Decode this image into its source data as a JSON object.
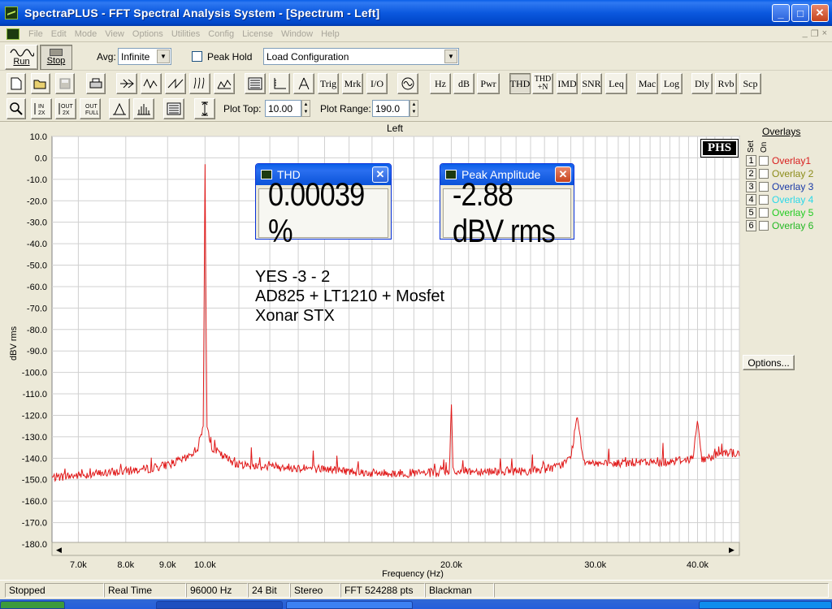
{
  "window": {
    "title": "SpectraPLUS - FFT Spectral Analysis System - [Spectrum - Left]",
    "minimize": "_",
    "maximize": "□",
    "close": "✕"
  },
  "menu": [
    "File",
    "Edit",
    "Mode",
    "View",
    "Options",
    "Utilities",
    "Config",
    "License",
    "Window",
    "Help"
  ],
  "mdi": {
    "minimize": "_",
    "restore": "❐",
    "close": "×"
  },
  "toolbar1": {
    "run": "Run",
    "stop": "Stop",
    "avg_label": "Avg:",
    "avg_value": "Infinite",
    "peak_hold_label": "Peak Hold",
    "config_value": "Load Configuration"
  },
  "toolbar2": {
    "trig": "Trig",
    "mrk": "Mrk",
    "io": "I/O",
    "hz": "Hz",
    "db": "dB",
    "pwr": "Pwr",
    "thd": "THD",
    "thdn_top": "THD",
    "thdn_bottom": "+N",
    "imd": "IMD",
    "snr": "SNR",
    "leq": "Leq",
    "mac": "Mac",
    "log": "Log",
    "dly": "Dly",
    "rvb": "Rvb",
    "scp": "Scp"
  },
  "toolbar3": {
    "plot_top_label": "Plot Top:",
    "plot_top_value": "10.00",
    "plot_range_label": "Plot Range:",
    "plot_range_value": "190.0"
  },
  "plot": {
    "title": "Left",
    "ylabel": "dBV rms",
    "xlabel": "Frequency (Hz)",
    "yticks": [
      "10.0",
      "0.0",
      "-10.0",
      "-20.0",
      "-30.0",
      "-40.0",
      "-50.0",
      "-60.0",
      "-70.0",
      "-80.0",
      "-90.0",
      "-100.0",
      "-110.0",
      "-120.0",
      "-130.0",
      "-140.0",
      "-150.0",
      "-160.0",
      "-170.0",
      "-180.0"
    ],
    "xticks": [
      "7.0k",
      "8.0k",
      "9.0k",
      "10.0k",
      "20.0k",
      "30.0k",
      "40.0k"
    ],
    "logo": "PHS",
    "annotation": [
      "YES -3 - 2",
      "AD825 + LT1210 + Mosfet",
      "Xonar STX"
    ]
  },
  "meters": {
    "thd": {
      "title": "THD",
      "value": "0.00039 %"
    },
    "peak": {
      "title": "Peak Amplitude",
      "value": "-2.88 dBV rms"
    }
  },
  "overlays": {
    "title": "Overlays",
    "set_label": "Set",
    "on_label": "On",
    "items": [
      {
        "num": "1",
        "name": "Overlay1",
        "color": "#d81e1e"
      },
      {
        "num": "2",
        "name": "Overlay 2",
        "color": "#8c8c1a"
      },
      {
        "num": "3",
        "name": "Overlay 3",
        "color": "#1a3aa8"
      },
      {
        "num": "4",
        "name": "Overlay 4",
        "color": "#2ad8e8"
      },
      {
        "num": "5",
        "name": "Overlay 5",
        "color": "#22cc22"
      },
      {
        "num": "6",
        "name": "Overlay 6",
        "color": "#22b822"
      }
    ],
    "options": "Options..."
  },
  "status": [
    "Stopped",
    "Real Time",
    "96000 Hz",
    "24 Bit",
    "Stereo",
    "FFT 524288 pts",
    "Blackman"
  ],
  "colors": {
    "trace": "#e01818",
    "grid": "#d0d0d0",
    "accent": "#0a5fe8"
  },
  "chart_data": {
    "type": "line",
    "title": "Left",
    "xlabel": "Frequency (Hz)",
    "ylabel": "dBV rms",
    "xscale": "log",
    "xlim": [
      6500,
      45000
    ],
    "ylim": [
      -180,
      10
    ],
    "grid": true,
    "series": [
      {
        "x": [
          6500,
          7000,
          7500,
          8000,
          8500,
          9000,
          9500,
          9800,
          9950,
          10000,
          10050,
          10200,
          10500,
          11000,
          12000,
          14000,
          16000,
          18000,
          19900,
          20000,
          20100,
          22000,
          25000,
          27000,
          28000,
          28500,
          29000,
          30000,
          31000,
          33000,
          36000,
          39500,
          40000,
          40500,
          43000,
          45000
        ],
        "y": [
          -149,
          -148,
          -147,
          -146,
          -145,
          -143,
          -140,
          -135,
          -125,
          -3,
          -125,
          -135,
          -139,
          -143,
          -144,
          -145,
          -147,
          -147,
          -147,
          -112,
          -146,
          -146,
          -146,
          -144,
          -140,
          -120,
          -141,
          -142,
          -143,
          -142,
          -142,
          -140,
          -122,
          -141,
          -137,
          -138
        ]
      }
    ]
  }
}
